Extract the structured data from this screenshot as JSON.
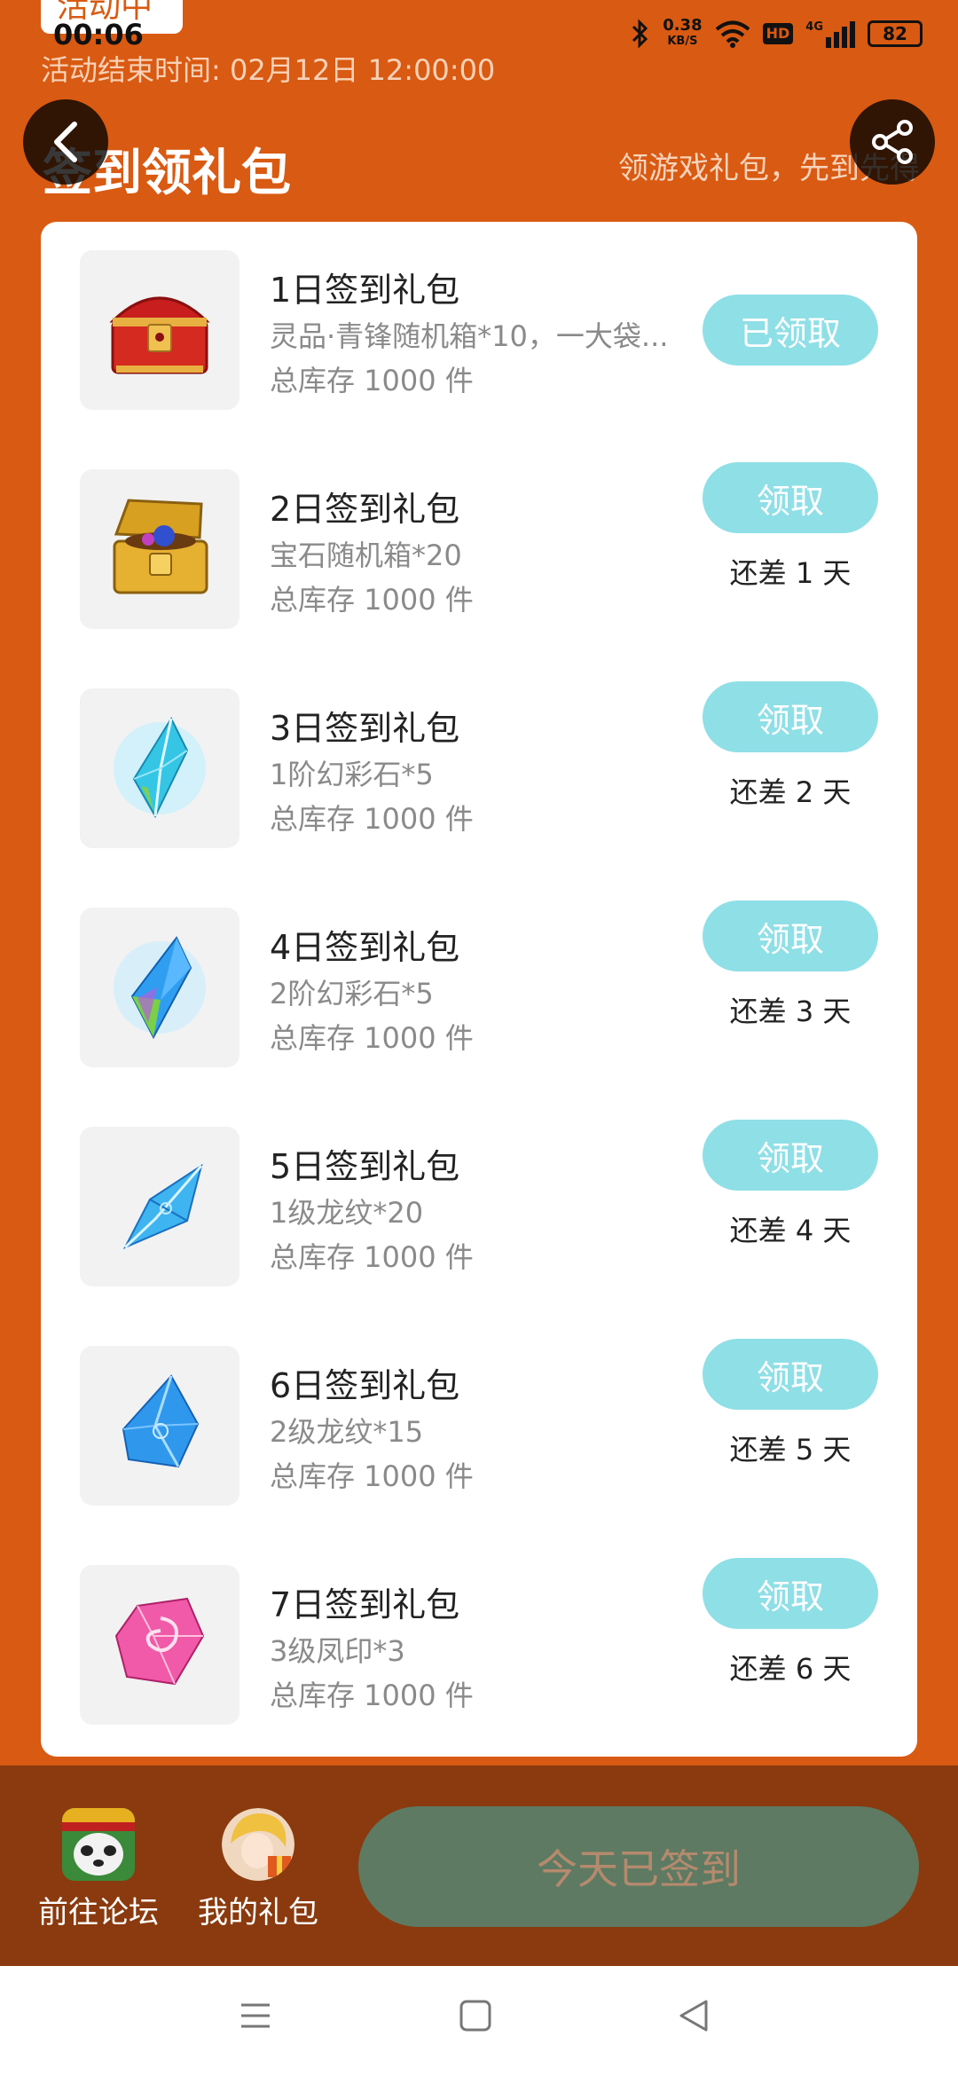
{
  "status_bar": {
    "time": "00:06",
    "network_speed": "0.38",
    "network_unit": "KB/S",
    "hd": "HD",
    "network_type": "4G",
    "battery": "82"
  },
  "badge": {
    "label": "活动中"
  },
  "header": {
    "end_time": "活动结束时间: 02月12日 12:00:00",
    "title": "签到领礼包",
    "slogan": "领游戏礼包，先到先得"
  },
  "gifts": [
    {
      "title": "1日签到礼包",
      "desc": "灵品·青锋随机箱*10，一大袋...",
      "stock": "总库存 1000 件",
      "button": "已领取",
      "remaining": ""
    },
    {
      "title": "2日签到礼包",
      "desc": "宝石随机箱*20",
      "stock": "总库存 1000 件",
      "button": "领取",
      "remaining": "还差 1 天"
    },
    {
      "title": "3日签到礼包",
      "desc": "1阶幻彩石*5",
      "stock": "总库存 1000 件",
      "button": "领取",
      "remaining": "还差 2 天"
    },
    {
      "title": "4日签到礼包",
      "desc": "2阶幻彩石*5",
      "stock": "总库存 1000 件",
      "button": "领取",
      "remaining": "还差 3 天"
    },
    {
      "title": "5日签到礼包",
      "desc": "1级龙纹*20",
      "stock": "总库存 1000 件",
      "button": "领取",
      "remaining": "还差 4 天"
    },
    {
      "title": "6日签到礼包",
      "desc": "2级龙纹*15",
      "stock": "总库存 1000 件",
      "button": "领取",
      "remaining": "还差 5 天"
    },
    {
      "title": "7日签到礼包",
      "desc": "3级凤印*3",
      "stock": "总库存 1000 件",
      "button": "领取",
      "remaining": "还差 6 天"
    }
  ],
  "bottom": {
    "forum_label": "前往论坛",
    "my_gifts_label": "我的礼包",
    "sign_button": "今天已签到"
  },
  "colors": {
    "header_bg": "#d95a12",
    "button_bg": "#8fdfe6",
    "bottom_bar_bg": "#8a3a0e",
    "sign_button_bg": "#5e7a62"
  }
}
